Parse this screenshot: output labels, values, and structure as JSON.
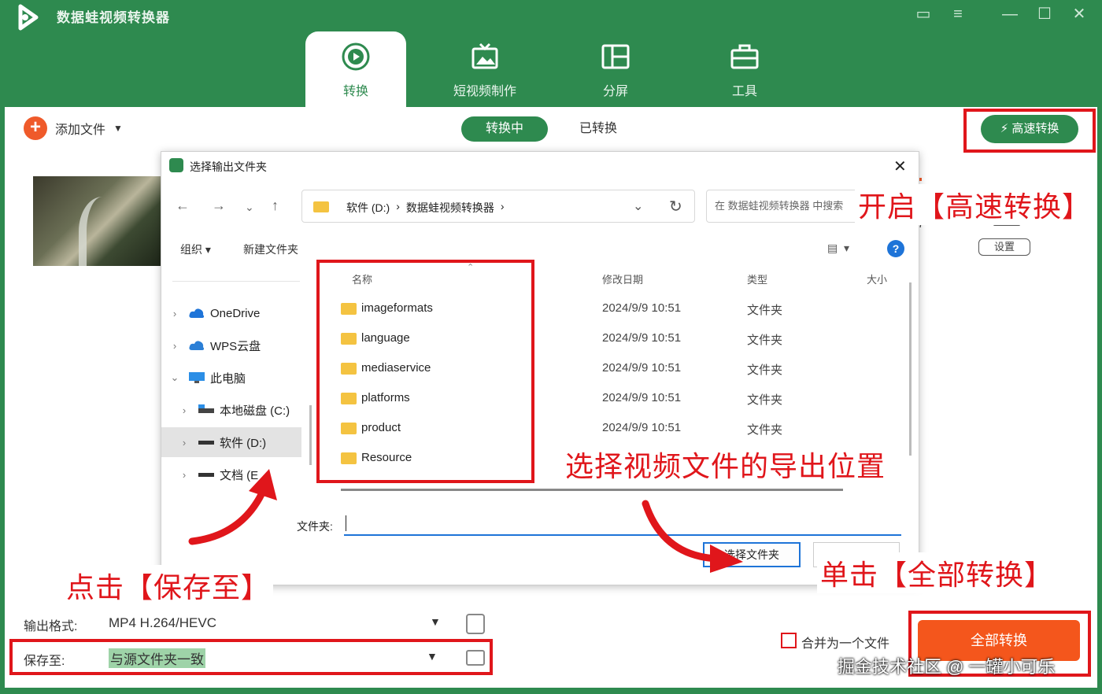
{
  "app": {
    "title": "数据蛙视频转换器"
  },
  "window_controls": [
    "feedback-icon",
    "menu-icon",
    "minimize-icon",
    "maximize-icon",
    "close-icon"
  ],
  "nav": {
    "tabs": [
      {
        "label": "转换",
        "icon": "convert-icon",
        "active": true
      },
      {
        "label": "短视频制作",
        "icon": "short-video-icon"
      },
      {
        "label": "分屏",
        "icon": "split-screen-icon"
      },
      {
        "label": "工具",
        "icon": "toolbox-icon"
      }
    ]
  },
  "toolbar": {
    "add_file": "添加文件",
    "seg_converting": "转换中",
    "seg_converted": "已转换",
    "high_speed": "高速转换"
  },
  "task": {
    "settings_label": "设置"
  },
  "dialog": {
    "title": "选择输出文件夹",
    "path": [
      "软件 (D:)",
      "数据蛙视频转换器"
    ],
    "search_placeholder": "在 数据蛙视频转换器 中搜索",
    "organize": "组织 ▾",
    "new_folder": "新建文件夹",
    "tree": [
      {
        "label": "OneDrive",
        "chev": "›",
        "icon": "cloud-icon"
      },
      {
        "label": "WPS云盘",
        "chev": "›",
        "icon": "cloud-icon"
      },
      {
        "label": "此电脑",
        "chev": "⌄",
        "icon": "computer-icon"
      },
      {
        "label": "本地磁盘 (C:)",
        "chev": "›",
        "icon": "drive-icon"
      },
      {
        "label": "软件 (D:)",
        "chev": "›",
        "icon": "drive-icon",
        "selected": true
      },
      {
        "label": "文档 (E",
        "chev": "›",
        "icon": "drive-icon"
      }
    ],
    "columns": {
      "name": "名称",
      "date": "修改日期",
      "type": "类型",
      "size": "大小"
    },
    "files": [
      {
        "name": "imageformats",
        "date": "2024/9/9 10:51",
        "type": "文件夹"
      },
      {
        "name": "language",
        "date": "2024/9/9 10:51",
        "type": "文件夹"
      },
      {
        "name": "mediaservice",
        "date": "2024/9/9 10:51",
        "type": "文件夹"
      },
      {
        "name": "platforms",
        "date": "2024/9/9 10:51",
        "type": "文件夹"
      },
      {
        "name": "product",
        "date": "2024/9/9 10:51",
        "type": "文件夹"
      },
      {
        "name": "Resource",
        "date": "",
        "type": ""
      }
    ],
    "folder_label": "文件夹:",
    "folder_value": "",
    "select_button": "选择文件夹"
  },
  "annotations": {
    "high_speed": "开启【高速转换】",
    "export_location": "选择视频文件的导出位置",
    "convert_all": "单击【全部转换】",
    "save_to": "点击【保存至】"
  },
  "bottom": {
    "output_label": "输出格式:",
    "output_value": "MP4 H.264/HEVC",
    "save_label": "保存至:",
    "save_value": "与源文件夹一致",
    "merge_label": "合并为一个文件",
    "convert_all": "全部转换"
  },
  "watermark": "掘金技术社区 @ 一罐小可乐",
  "colors": {
    "brand_green": "#2e8a4f",
    "accent_orange": "#f4561c",
    "annotation_red": "#e0161b",
    "link_blue": "#1e74d8"
  }
}
